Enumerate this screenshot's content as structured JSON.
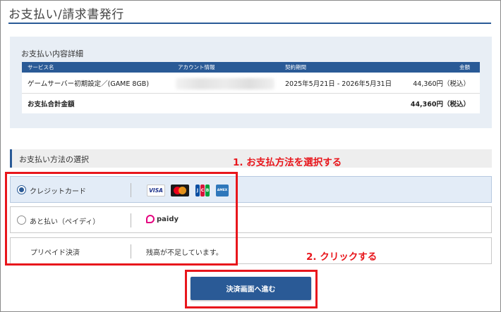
{
  "page": {
    "title": "お支払い/請求書発行"
  },
  "summary": {
    "title": "お支払い内容詳細",
    "headers": [
      "サービス名",
      "アカウント情報",
      "契約期間",
      "金額"
    ],
    "item": {
      "service": "ゲームサーバー初期設定／(GAME 8GB)",
      "period": "2025年5月21日 - 2026年5月31日",
      "amount": "44,360円（税込）"
    },
    "total": {
      "label": "お支払合計金額",
      "amount": "44,360円（税込）"
    }
  },
  "payment_section": {
    "title": "お支払い方法の選択"
  },
  "payment_methods": [
    {
      "label": "クレジットカード",
      "selected": true,
      "logos": [
        "visa",
        "mastercard",
        "jcb",
        "amex"
      ]
    },
    {
      "label": "あと払い（ペイディ）",
      "selected": false,
      "brand": "paidy"
    },
    {
      "label": "プリペイド決済",
      "info": "残高が不足しています。"
    }
  ],
  "logo_text": {
    "visa": "VISA",
    "jcb": [
      "J",
      "C",
      "B"
    ],
    "amex": "AMEX"
  },
  "annotations": {
    "step1": "1.  お支払方法を選択する",
    "step2": "2.  クリックする"
  },
  "proceed_button": {
    "label": "決済画面へ進む"
  },
  "colors": {
    "primary": "#2a5a96",
    "highlight": "#e8161c",
    "panel": "#e8eef5",
    "paidy": "#e4007e"
  }
}
